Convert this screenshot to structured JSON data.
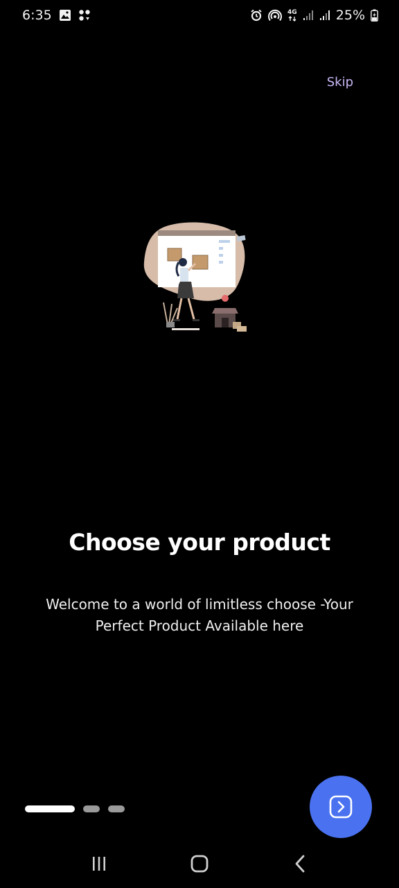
{
  "status_bar": {
    "time": "6:35",
    "battery": "25%",
    "network": "4G"
  },
  "skip_label": "Skip",
  "onboarding": {
    "title": "Choose your product",
    "subtitle": "Welcome to a world of limitless choose -Your Perfect Product Available here",
    "page_index": 0,
    "page_count": 3
  },
  "colors": {
    "background": "#000000",
    "accent": "#4a72f0",
    "skip_text": "#c9b8f6",
    "indicator_active": "#ffffff",
    "indicator_inactive": "#9a9a9a"
  },
  "icons": {
    "fab": "chevron-right-icon",
    "nav_recents": "recents-icon",
    "nav_home": "home-icon",
    "nav_back": "back-icon"
  }
}
